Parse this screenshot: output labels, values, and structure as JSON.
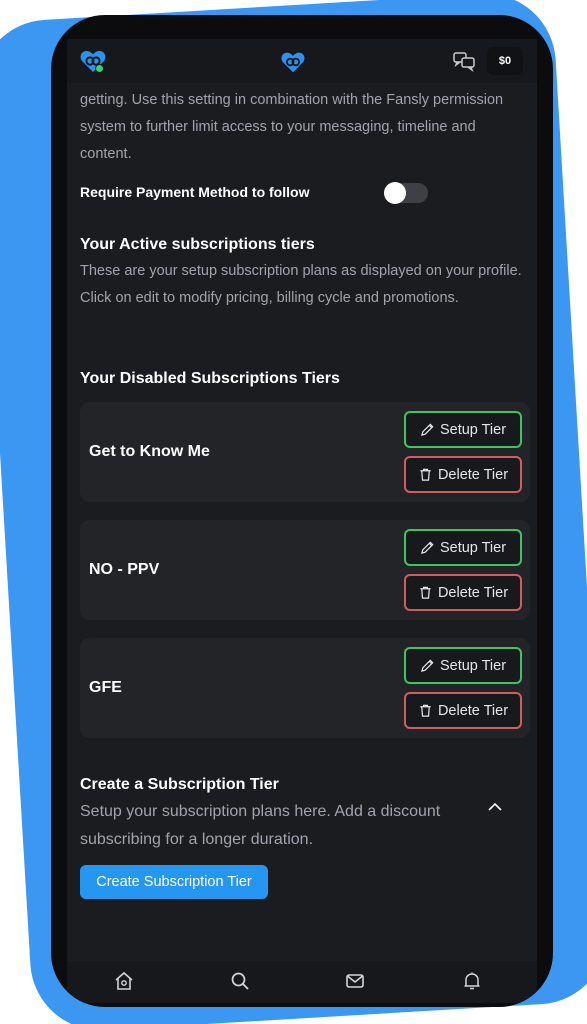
{
  "colors": {
    "accent_blue": "#2697f0",
    "setup_border": "#3ec561",
    "delete_border": "#d05d60",
    "background": "#1b1c20",
    "card": "#232428",
    "frame_blue": "#3b97f2"
  },
  "topbar": {
    "left_logo_icon": "fansly-heart-logo-icon",
    "center_logo_icon": "fansly-heart-logo-icon",
    "chat_icon": "chat-bubbles-icon",
    "wallet_label": "$0"
  },
  "settings": {
    "intro_text": "getting. Use this setting in combination with the Fansly permission system to further limit access to your messaging, timeline and content.",
    "require_payment_label": "Require Payment Method to follow",
    "require_payment_enabled": false
  },
  "active_tiers": {
    "title": "Your Active subscriptions tiers",
    "description": "These are your setup subscription plans as displayed on your profile. Click on edit to modify pricing, billing cycle and promotions."
  },
  "disabled_tiers": {
    "title": "Your Disabled Subscriptions Tiers",
    "setup_label": "Setup Tier",
    "delete_label": "Delete Tier",
    "items": [
      {
        "name": "Get to Know Me"
      },
      {
        "name": "NO - PPV"
      },
      {
        "name": "GFE"
      }
    ]
  },
  "create_tier": {
    "title": "Create a Subscription Tier",
    "description": "Setup your subscription plans here. Add a discount subscribing for a longer duration.",
    "button_label": "Create Subscription Tier"
  },
  "bottom_nav": {
    "items": [
      "home-icon",
      "search-icon",
      "mail-icon",
      "bell-icon"
    ]
  }
}
